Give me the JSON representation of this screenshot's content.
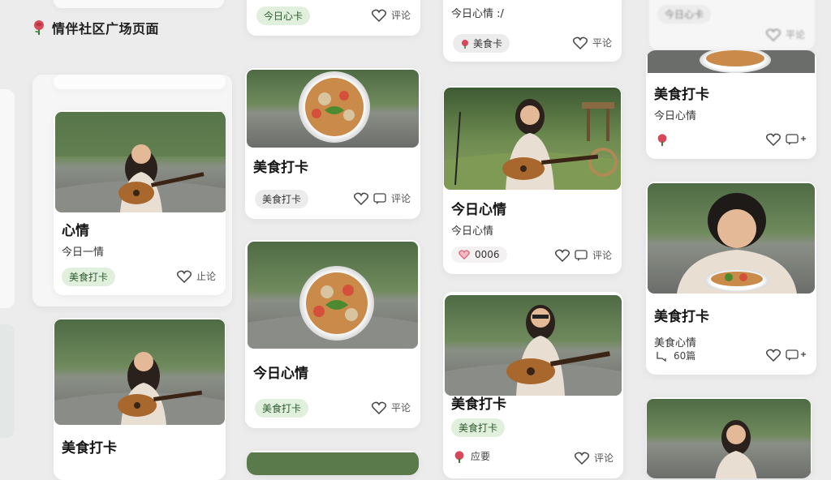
{
  "header": {
    "title": "情伴社区广场页面",
    "logo_icon": "rose-icon"
  },
  "colors": {
    "background": "#ececed",
    "tag_green_bg": "#e1f0dc",
    "tag_green_text": "#2b5a2f",
    "heart_red": "#d85a6a"
  },
  "col1": {
    "top_partial": {},
    "card2": {
      "title": "心情",
      "subtitle": "今日一情",
      "tag": "美食打卡",
      "comment": "止论"
    },
    "card3": {
      "title": "美食打卡"
    }
  },
  "col2": {
    "card1": {
      "tag": "今日心卡",
      "comment": "评论"
    },
    "card2": {
      "title": "美食打卡",
      "tag": "美食打卡",
      "comment": "评论"
    },
    "card3": {
      "title": "今日心情",
      "tag": "美食打卡",
      "comment": "平论"
    }
  },
  "col3": {
    "card1": {
      "subtitle": "今日心情 :/",
      "tag": "美食卡",
      "comment": "平论"
    },
    "card2": {
      "title": "今日心情",
      "subtitle": "今日心情",
      "like_count": "0006",
      "comment": "评论"
    },
    "card3": {
      "title": "美食打卡",
      "tag": "美食打卡",
      "comment": "评论",
      "chip": "应要"
    }
  },
  "col4": {
    "card1": {
      "tag": "今日心卡",
      "comment": "平论"
    },
    "card2": {
      "title": "美食打卡",
      "subtitle": "今日心情"
    },
    "card3": {
      "title": "美食打卡",
      "subtitle": "美食心情",
      "chip": "60篇"
    }
  }
}
